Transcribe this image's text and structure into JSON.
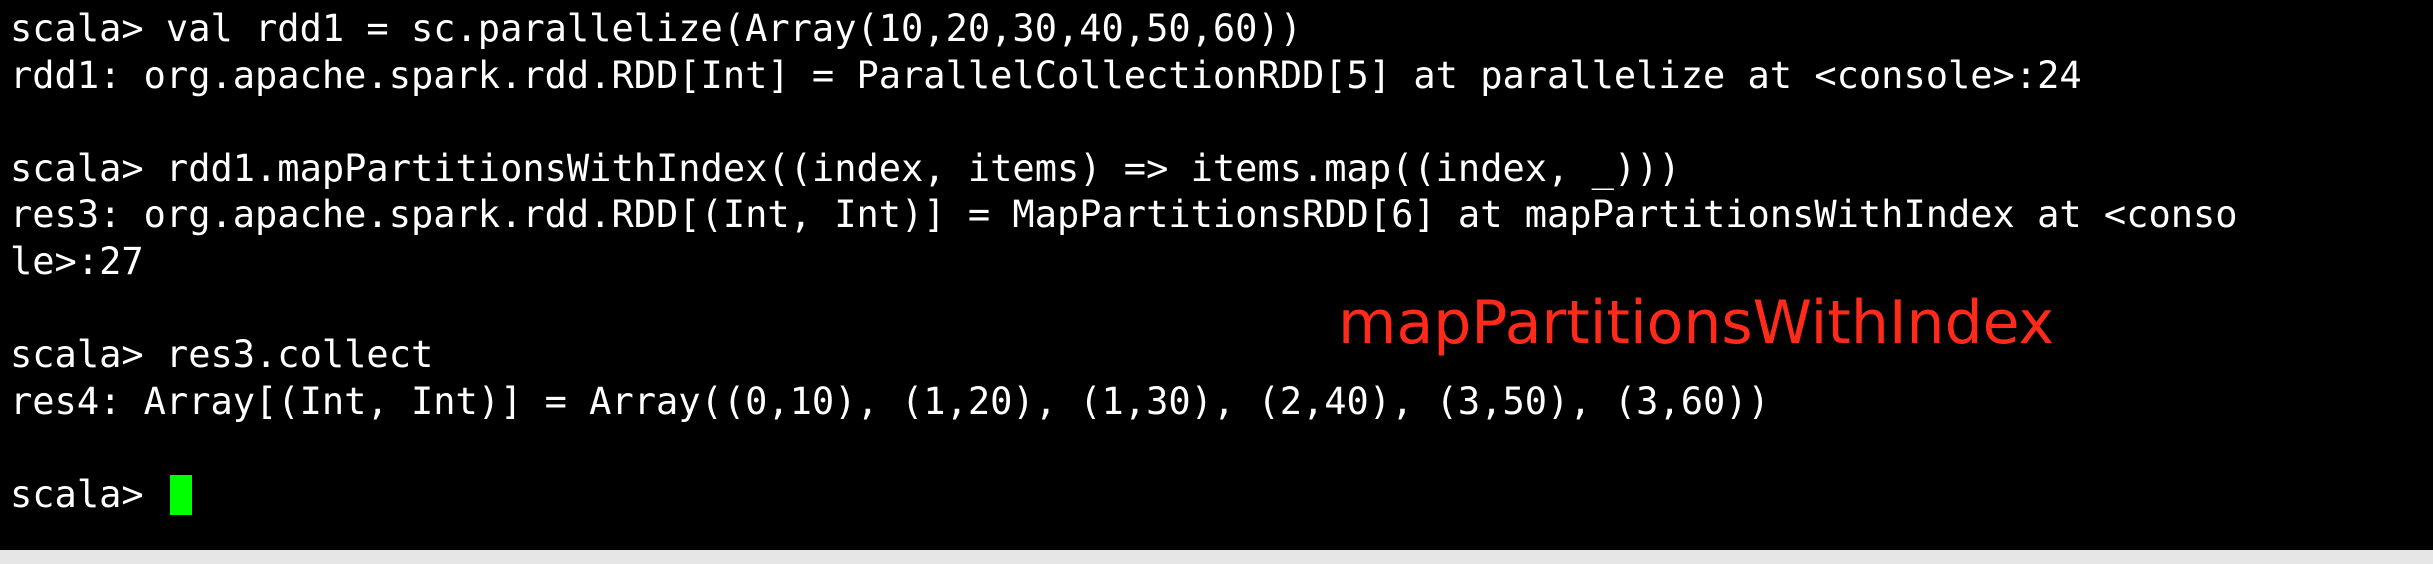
{
  "terminal": {
    "lines": [
      "scala> val rdd1 = sc.parallelize(Array(10,20,30,40,50,60))",
      "rdd1: org.apache.spark.rdd.RDD[Int] = ParallelCollectionRDD[5] at parallelize at <console>:24",
      "",
      "scala> rdd1.mapPartitionsWithIndex((index, items) => items.map((index, _)))",
      "res3: org.apache.spark.rdd.RDD[(Int, Int)] = MapPartitionsRDD[6] at mapPartitionsWithIndex at <conso",
      "le>:27",
      "",
      "scala> res3.collect",
      "res4: Array[(Int, Int)] = Array((0,10), (1,20), (1,30), (2,40), (3,50), (3,60))",
      "",
      "scala> "
    ],
    "cursor_color": "#00ff00",
    "text_color": "#ffffff",
    "background": "#000000"
  },
  "annotation": {
    "text": "mapPartitionsWithIndex",
    "color": "#ff2a1a"
  }
}
